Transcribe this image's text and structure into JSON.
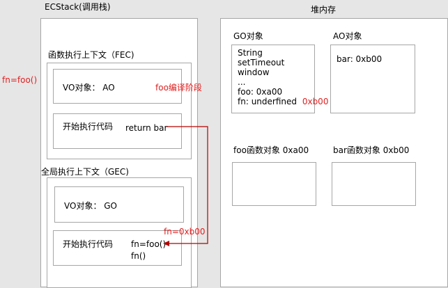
{
  "ecstack": {
    "title": "ECStack(调用栈)",
    "fec": {
      "title": "函数执行上下文（FEC)",
      "vo_label": "VO对象：  AO",
      "exec_label": "开始执行代码",
      "exec_code": "return bar"
    },
    "gec": {
      "title": "全局执行上下文（GEC)",
      "vo_label": "VO对象：  GO",
      "exec_label": "开始执行代码",
      "code_line1": "fn=foo()",
      "code_line2": "fn()"
    }
  },
  "heap": {
    "title": "堆内存",
    "go": {
      "title": "GO对象",
      "lines": [
        "String",
        "setTimeout",
        "window",
        "...",
        "foo: 0xa00"
      ],
      "fn_line": "fn: underfined",
      "fn_update": "0xb00"
    },
    "ao": {
      "title": "AO对象",
      "lines": [
        "bar: 0xb00"
      ]
    },
    "foo_obj_title": "foo函数对象 0xa00",
    "bar_obj_title": "bar函数对象 0xb00"
  },
  "annotations": {
    "left_note": "fn=foo()",
    "compile_note": "foo编译阶段",
    "arrow_label": "fn=0xb00"
  },
  "colors": {
    "annotation": "#e21f1f",
    "arrow": "#b20000",
    "border": "#a6a6a6",
    "background": "#e6e6e6"
  }
}
